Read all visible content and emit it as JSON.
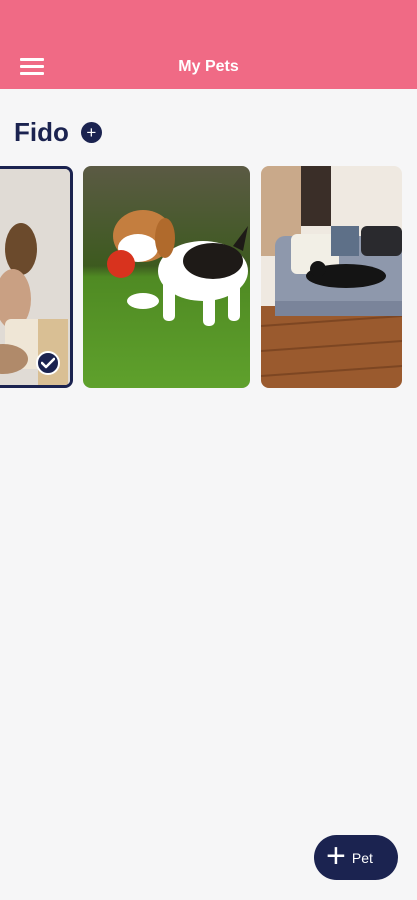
{
  "app_bar": {
    "title": "My Pets",
    "color": "#f06a85",
    "menu_icon": "hamburger-menu-icon"
  },
  "pet": {
    "name": "Fido",
    "add_icon": "plus-circle-icon"
  },
  "photos": [
    {
      "subject": "person with dog",
      "selected": true
    },
    {
      "subject": "beagle puppy with red ball",
      "selected": false
    },
    {
      "subject": "black dog on gray couch",
      "selected": false
    }
  ],
  "fab": {
    "label": "Pet",
    "icon": "plus-icon",
    "color": "#1b2350"
  }
}
